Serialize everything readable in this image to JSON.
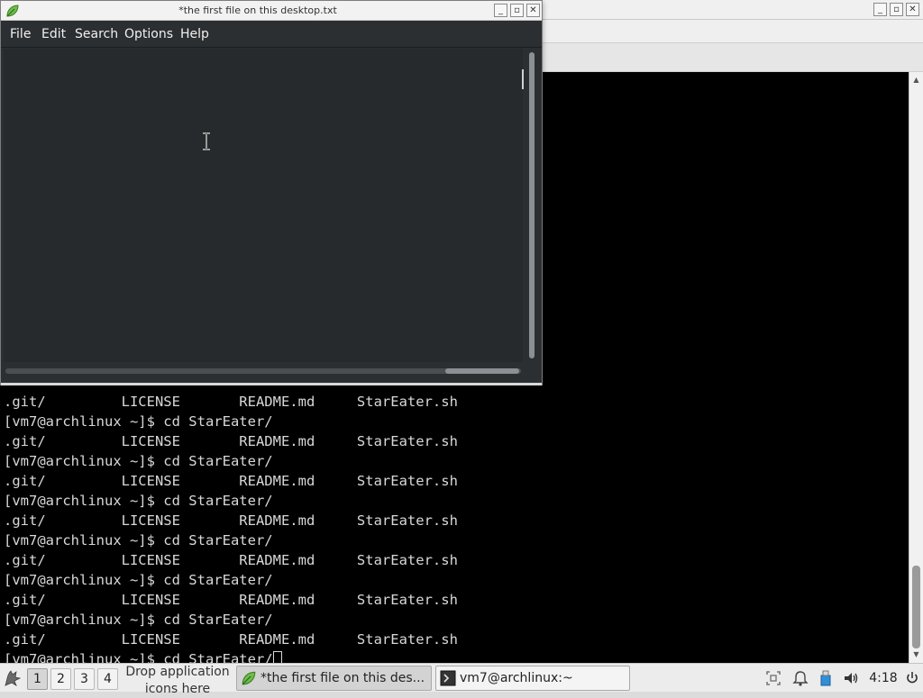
{
  "terminal": {
    "lines": [
      ".git/         LICENSE       README.md     StarEater.sh",
      "[vm7@archlinux ~]$ cd StarEater/",
      ".git/         LICENSE       README.md     StarEater.sh",
      "[vm7@archlinux ~]$ cd StarEater/",
      ".git/         LICENSE       README.md     StarEater.sh",
      "[vm7@archlinux ~]$ cd StarEater/",
      ".git/         LICENSE       README.md     StarEater.sh",
      "[vm7@archlinux ~]$ cd StarEater/",
      ".git/         LICENSE       README.md     StarEater.sh",
      "[vm7@archlinux ~]$ cd StarEater/",
      ".git/         LICENSE       README.md     StarEater.sh",
      "[vm7@archlinux ~]$ cd StarEater/",
      ".git/         LICENSE       README.md     StarEater.sh"
    ],
    "current_prompt": "[vm7@archlinux ~]$ cd StarEater/",
    "window_buttons": {
      "minimize": "_",
      "maximize": "▫",
      "close": "✕"
    }
  },
  "editor": {
    "title": "*the first file on this desktop.txt",
    "menu": [
      "File",
      "Edit",
      "Search",
      "Options",
      "Help"
    ],
    "content": "",
    "window_buttons": {
      "minimize": "_",
      "maximize": "▫",
      "close": "✕"
    },
    "icon": "leafpad-icon"
  },
  "taskbar": {
    "workspaces": [
      "1",
      "2",
      "3",
      "4"
    ],
    "active_workspace": "1",
    "drop_hint": "Drop application icons here",
    "tasks": [
      {
        "label": "*the first file on this des...",
        "icon": "leafpad-icon",
        "active": true
      },
      {
        "label": "vm7@archlinux:~",
        "icon": "terminal-icon",
        "active": false
      }
    ],
    "tray": [
      "screenshot-icon",
      "bell-icon",
      "usb-icon",
      "volume-icon"
    ],
    "clock": "4:18"
  }
}
